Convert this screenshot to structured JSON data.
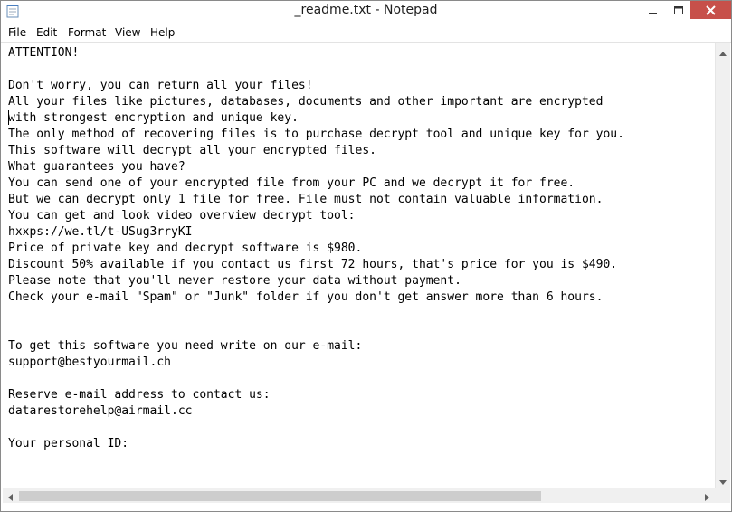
{
  "window": {
    "title": "_readme.txt - Notepad",
    "close_color": "#c7504a"
  },
  "menu": {
    "items": [
      "File",
      "Edit",
      "Format",
      "View",
      "Help"
    ]
  },
  "document": {
    "lines": [
      "ATTENTION!",
      "",
      "Don't worry, you can return all your files!",
      "All your files like pictures, databases, documents and other important are encrypted",
      "with strongest encryption and unique key.",
      "The only method of recovering files is to purchase decrypt tool and unique key for you.",
      "This software will decrypt all your encrypted files.",
      "What guarantees you have?",
      "You can send one of your encrypted file from your PC and we decrypt it for free.",
      "But we can decrypt only 1 file for free. File must not contain valuable information.",
      "You can get and look video overview decrypt tool:",
      "hxxps://we.tl/t-USug3rryKI",
      "Price of private key and decrypt software is $980.",
      "Discount 50% available if you contact us first 72 hours, that's price for you is $490.",
      "Please note that you'll never restore your data without payment.",
      "Check your e-mail \"Spam\" or \"Junk\" folder if you don't get answer more than 6 hours.",
      "",
      "",
      "To get this software you need write on our e-mail:",
      "support@bestyourmail.ch",
      "",
      "Reserve e-mail address to contact us:",
      "datarestorehelp@airmail.cc",
      "",
      "Your personal ID:"
    ]
  },
  "icons": {
    "app": "notepad-icon",
    "minimize": "minimize-icon",
    "maximize": "maximize-icon",
    "close": "close-icon"
  }
}
